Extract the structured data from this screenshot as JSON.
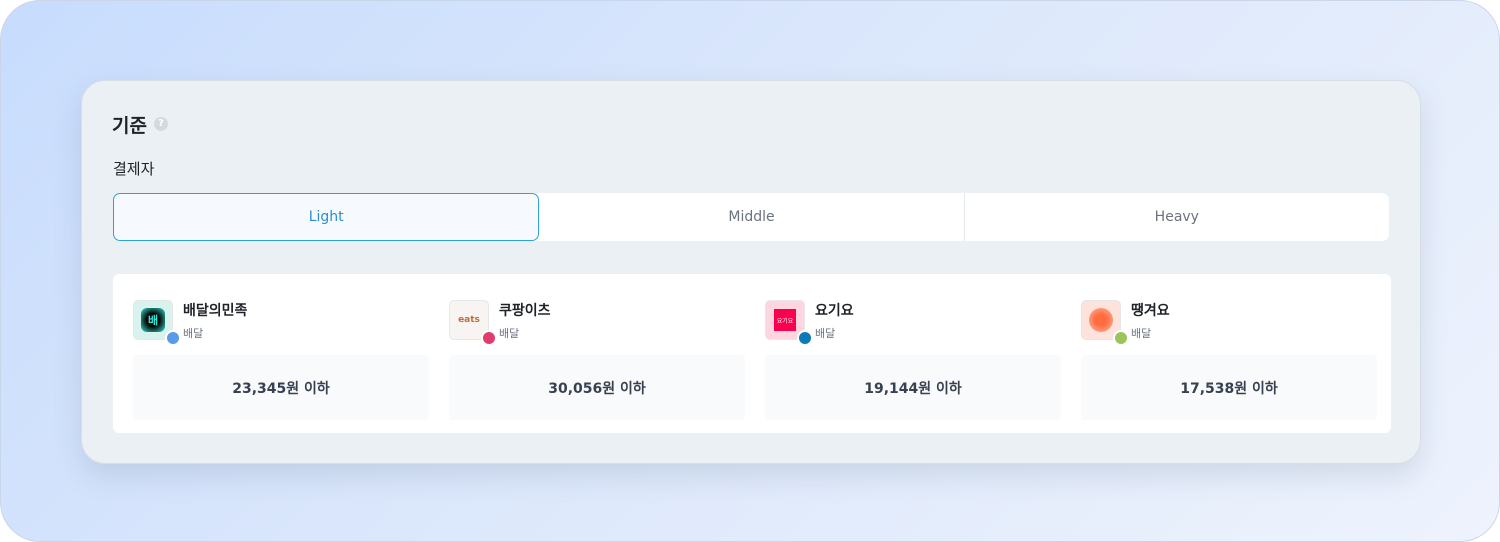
{
  "section": {
    "title": "기준",
    "help_icon": "question-circle-icon",
    "subtitle": "결제자"
  },
  "tabs": [
    {
      "label": "Light",
      "active": true
    },
    {
      "label": "Middle",
      "active": false
    },
    {
      "label": "Heavy",
      "active": false
    }
  ],
  "apps": [
    {
      "name": "배달의민족",
      "category": "배달",
      "value": "23,345원 이하",
      "logo_text": "배",
      "dot_color": "#5a9be8"
    },
    {
      "name": "쿠팡이츠",
      "category": "배달",
      "value": "30,056원 이하",
      "logo_text": "eats",
      "dot_color": "#e23c6c"
    },
    {
      "name": "요기요",
      "category": "배달",
      "value": "19,144원 이하",
      "logo_text": "요기요",
      "dot_color": "#0b7bb8"
    },
    {
      "name": "땡겨요",
      "category": "배달",
      "value": "17,538원 이하",
      "logo_text": "",
      "dot_color": "#9bc45a"
    }
  ],
  "colors": {
    "accent": "#2ea3d9"
  }
}
